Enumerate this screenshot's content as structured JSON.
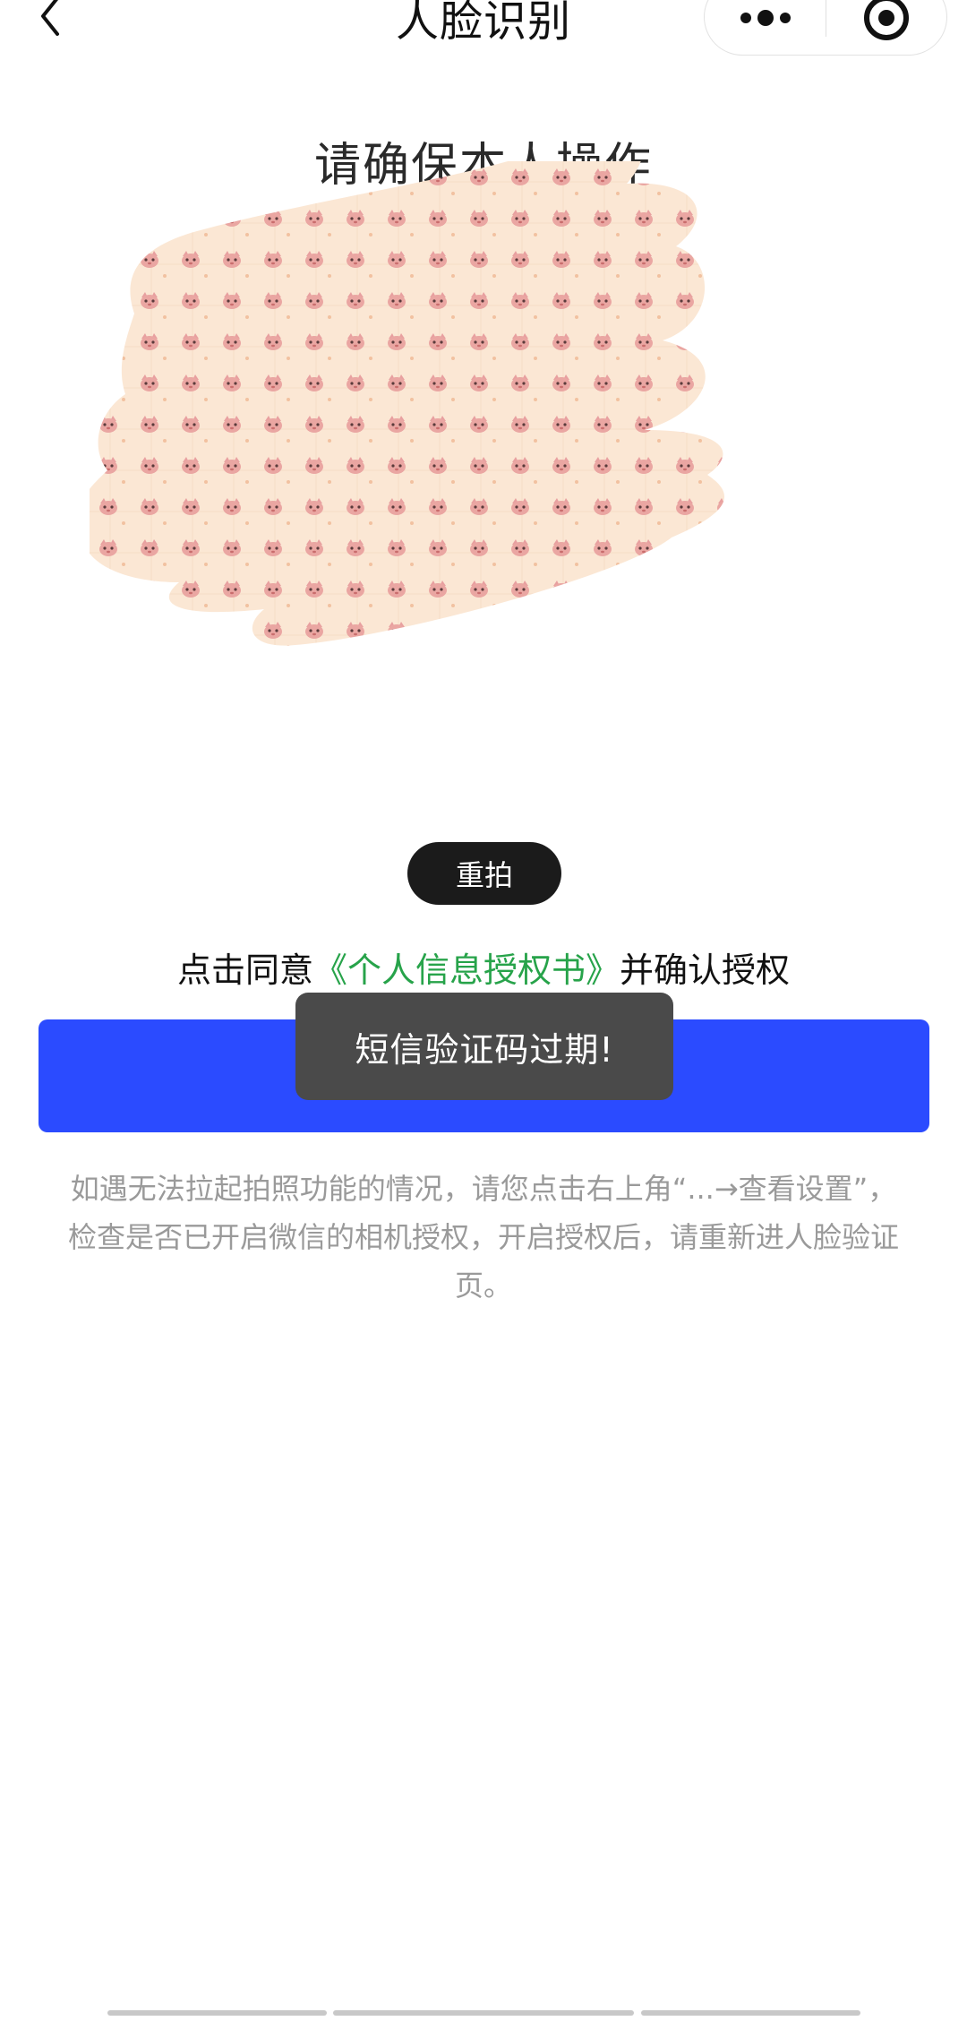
{
  "nav": {
    "title": "人脸识别"
  },
  "header": {
    "instruction": "请确保本人操作"
  },
  "photo": {
    "retake_label": "重拍",
    "background_color": "#fbe6d2",
    "pattern_color": "#e79a9a"
  },
  "agreement": {
    "prefix": "点击同意",
    "link_text": "《个人信息授权书》",
    "suffix": "并确认授权"
  },
  "primary_button": {
    "label": "",
    "color": "#2b4bff"
  },
  "toast": {
    "message": "短信验证码过期!"
  },
  "help": {
    "text": "如遇无法拉起拍照功能的情况，请您点击右上角“...→查看设置”，检查是否已开启微信的相机授权，开启授权后，请重新进人脸验证页。"
  },
  "colors": {
    "link_green": "#27a34a",
    "accent_blue": "#2b4bff",
    "toast_bg": "#4a4a4a"
  }
}
